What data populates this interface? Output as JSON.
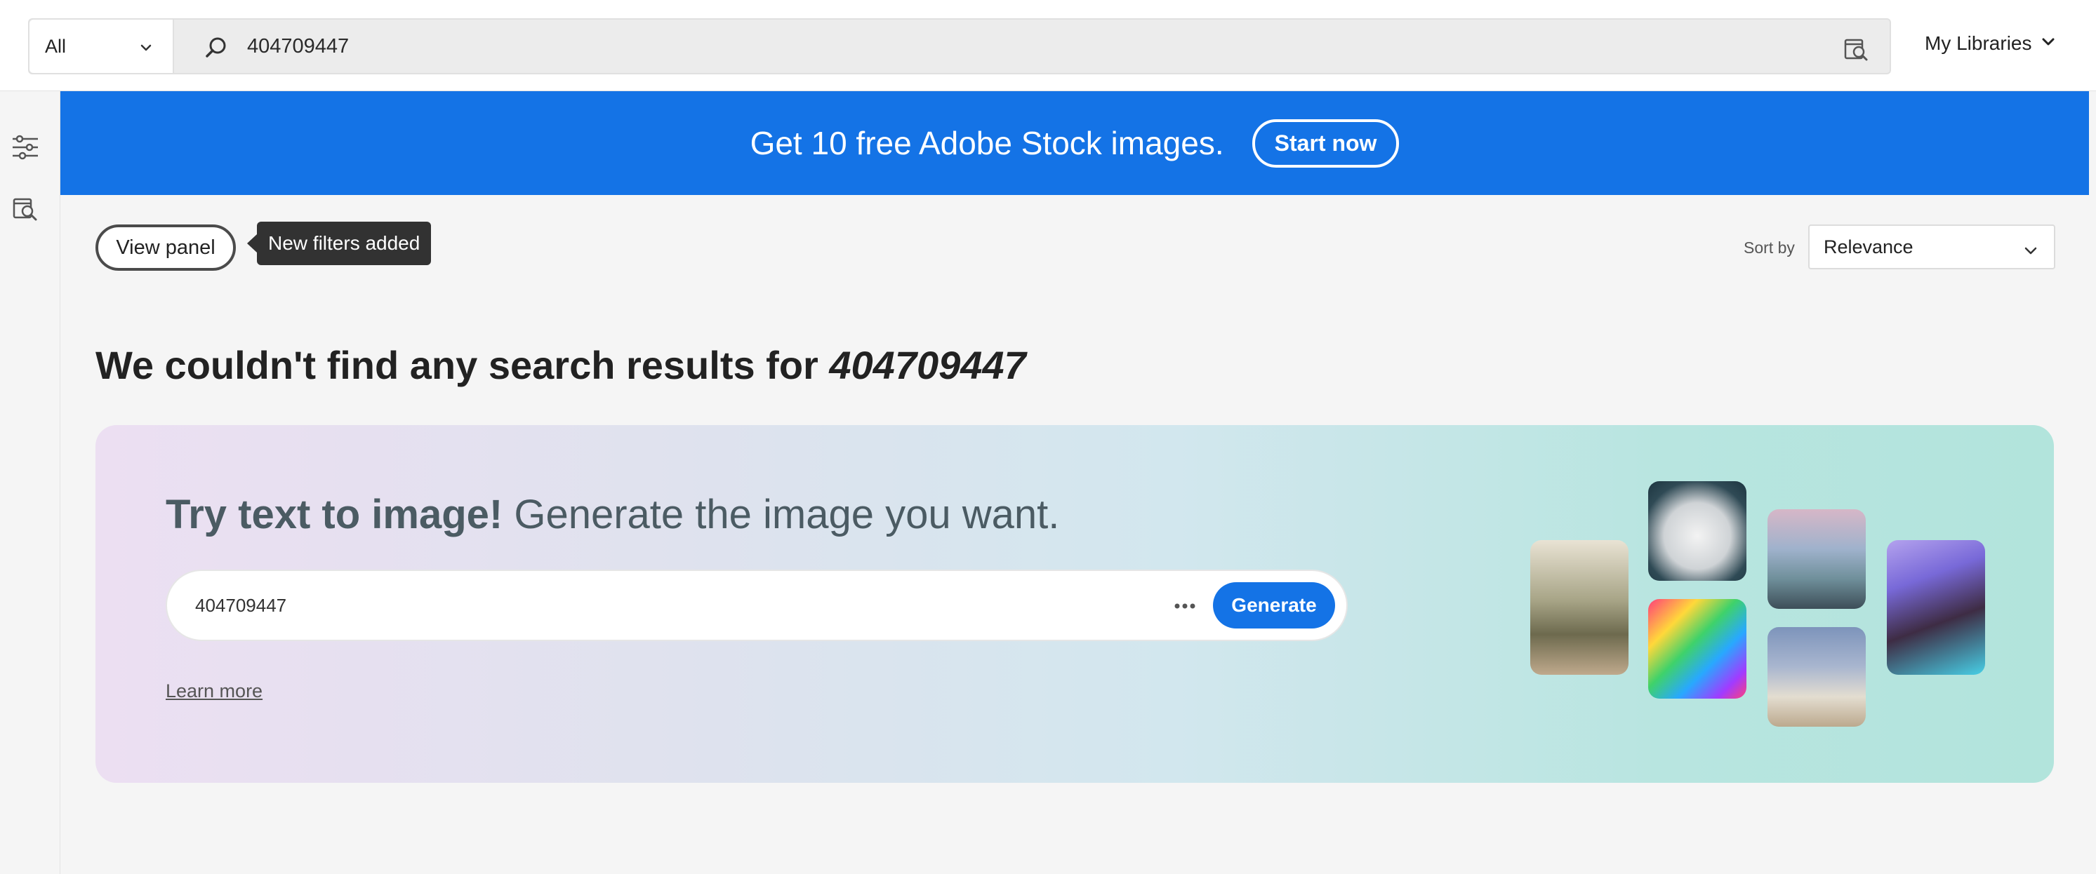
{
  "search": {
    "scope": "All",
    "query": "404709447"
  },
  "header": {
    "libraries_label": "My Libraries"
  },
  "banner": {
    "message": "Get 10 free Adobe Stock images.",
    "cta": "Start now"
  },
  "toolbar": {
    "view_panel": "View panel",
    "tooltip": "New filters added",
    "sort_label": "Sort by",
    "sort_value": "Relevance"
  },
  "results": {
    "no_results_prefix": "We couldn't find any search results for ",
    "query": "404709447"
  },
  "t2i": {
    "title_bold": "Try text to image!",
    "title_rest": " Generate the image you want.",
    "prompt_value": "404709447",
    "generate": "Generate",
    "learn_more": "Learn more"
  },
  "colors": {
    "brand_blue": "#1473e6",
    "tooltip_bg": "#323232"
  },
  "icons": [
    "chevron-down-icon",
    "search-icon",
    "visual-search-icon",
    "filters-icon",
    "more-icon"
  ]
}
